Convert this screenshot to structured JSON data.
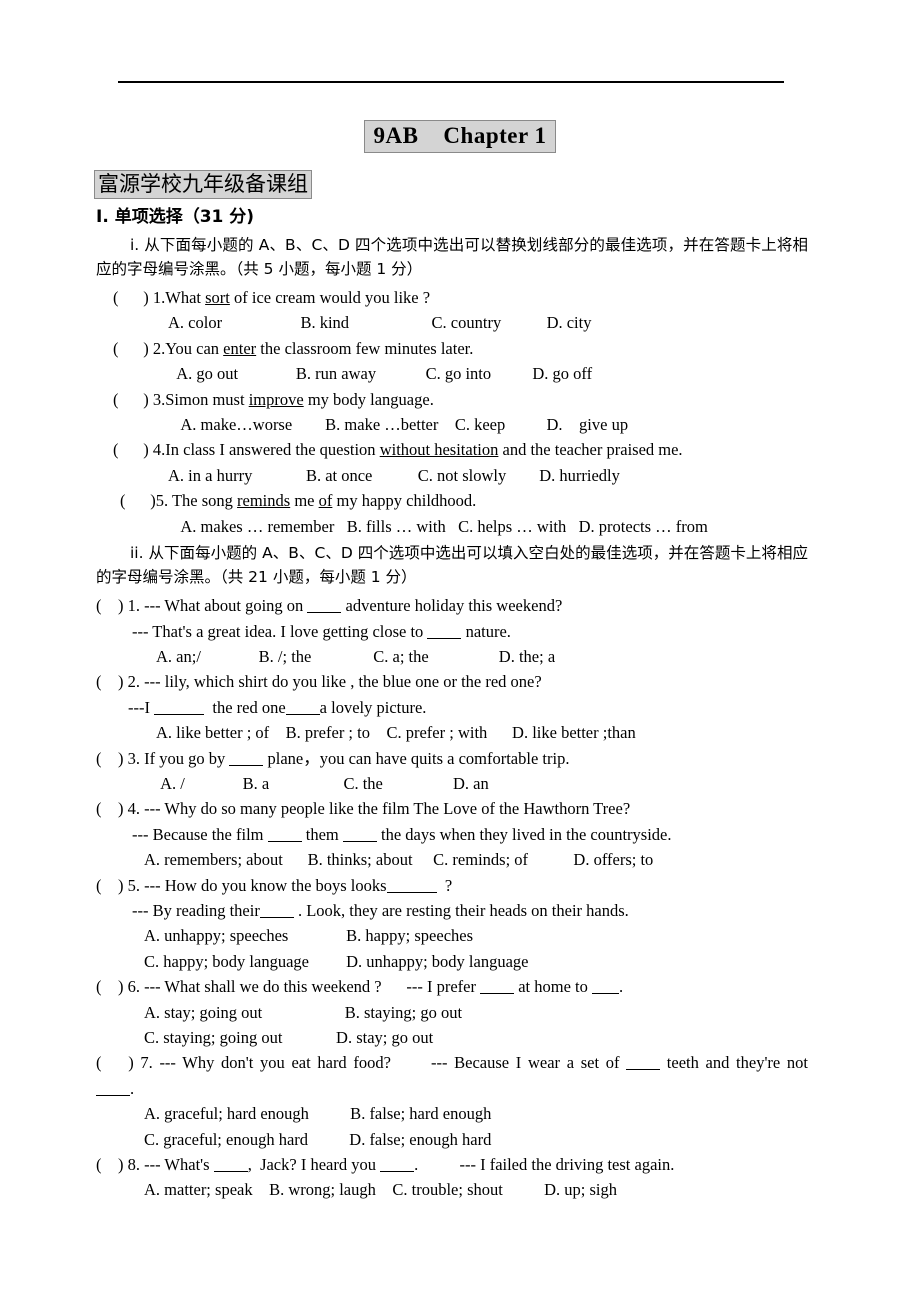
{
  "document": {
    "chapter_title": "9AB    Chapter 1",
    "school_title": "富源学校九年级备课组",
    "section_heading": "I. 单项选择（31 分)"
  },
  "part_i": {
    "instruction": "i. 从下面每小题的 A、B、C、D 四个选项中选出可以替换划线部分的最佳选项，并在答题卡上将相应的字母编号涂黑。（共 5 小题，每小题 1 分）",
    "questions": [
      {
        "bracket": "(      ) ",
        "number": "1.",
        "stem_pre": "What ",
        "stem_underline": "sort",
        "stem_post": " of ice cream would you like ?",
        "options": "A. color                   B. kind                    C. country           D. city"
      },
      {
        "bracket": "(      ) ",
        "number": "2.",
        "stem_pre": "You can ",
        "stem_underline": "enter",
        "stem_post": " the classroom few minutes later.",
        "options": "  A. go out              B. run away            C. go into          D. go off"
      },
      {
        "bracket": "(      ) ",
        "number": "3.",
        "stem_pre": "Simon must ",
        "stem_underline": "improve",
        "stem_post": " my body language.",
        "options": "   A. make…worse        B. make …better    C. keep          D.    give up"
      },
      {
        "bracket": "(      ) ",
        "number": "4.",
        "stem_pre": "In class I answered the question ",
        "stem_underline": "without hesitation",
        "stem_post": " and the teacher praised me.",
        "options": "A. in a hurry             B. at once           C. not slowly        D. hurriedly"
      },
      {
        "bracket": "(      )",
        "number": "5. ",
        "stem_pre": "The song ",
        "stem_underline": "reminds",
        "stem_mid": " me ",
        "stem_underline2": "of",
        "stem_post": " my happy childhood.",
        "options": "   A. makes … remember   B. fills … with   C. helps … with   D. protects … from"
      }
    ]
  },
  "part_ii": {
    "instruction": "ii. 从下面每小题的 A、B、C、D 四个选项中选出可以填入空白处的最佳选项，并在答题卡上将相应的字母编号涂黑。（共 21 小题，每小题 1 分）",
    "questions": [
      {
        "bracket": "(    ) ",
        "number": "1. ",
        "line1_a": "--- What about going on ",
        "line1_b": " adventure holiday this weekend?",
        "line2_a": "--- That's a great idea. I love getting close to ",
        "line2_b": " nature.",
        "options": "A. an;/              B. /; the               C. a; the                 D. the; a"
      },
      {
        "bracket": "(    ) ",
        "number": "2. ",
        "line1_a": "--- lily, which shirt do you like , the blue one or the red one?",
        "line2_a": "---I ",
        "line2_b": "  the red one",
        "line2_c": "a lovely picture.",
        "options": "A. like better ; of    B. prefer ; to    C. prefer ; with      D. like better ;than"
      },
      {
        "bracket": "(    ) ",
        "number": "3. ",
        "line1_a": "If you go by ",
        "line1_b": " plane，you can have quits a comfortable trip.",
        "options": " A. /              B. a                  C. the                 D. an"
      },
      {
        "bracket": "(    ) ",
        "number": "4. ",
        "line1_a": "--- Why do so many people like the film The Love of the Hawthorn Tree?",
        "line2_a": "--- Because the film ",
        "line2_b": " them ",
        "line2_c": " the days when they lived in the countryside.",
        "options": "A. remembers; about      B. thinks; about     C. reminds; of           D. offers; to"
      },
      {
        "bracket": "(    ) ",
        "number": "5. ",
        "line1_a": "--- How do you know the boys looks",
        "line1_b": "  ?",
        "line2_a": "--- By reading their",
        "line2_b": " . Look, they are resting their heads on their hands.",
        "options_row1": "A. unhappy; speeches              B. happy; speeches",
        "options_row2": "C. happy; body language         D. unhappy; body language"
      },
      {
        "bracket": "(    ) ",
        "number": "6. ",
        "line1_a": "--- What shall we do this weekend ?      --- I prefer ",
        "line1_b": " at home to ",
        "line1_c": ".",
        "options_row1": "A. stay; going out                    B. staying; go out",
        "options_row2": "C. staying; going out             D. stay; go out"
      },
      {
        "bracket": "(    ) ",
        "number": "7. ",
        "line1_a": "--- Why don't you eat hard food?      --- Because I wear a set of ",
        "line1_b": " teeth and they're not",
        "line2_b": ".",
        "options_row1": "A. graceful; hard enough          B. false; hard enough",
        "options_row2": "C. graceful; enough hard          D. false; enough hard"
      },
      {
        "bracket": "(    ) ",
        "number": "8. ",
        "line1_a": "--- What's ",
        "line1_b": ",  Jack? I heard you ",
        "line1_c": ".          --- I failed the driving test again.",
        "options": "A. matter; speak    B. wrong; laugh    C. trouble; shout          D. up; sigh"
      }
    ]
  }
}
